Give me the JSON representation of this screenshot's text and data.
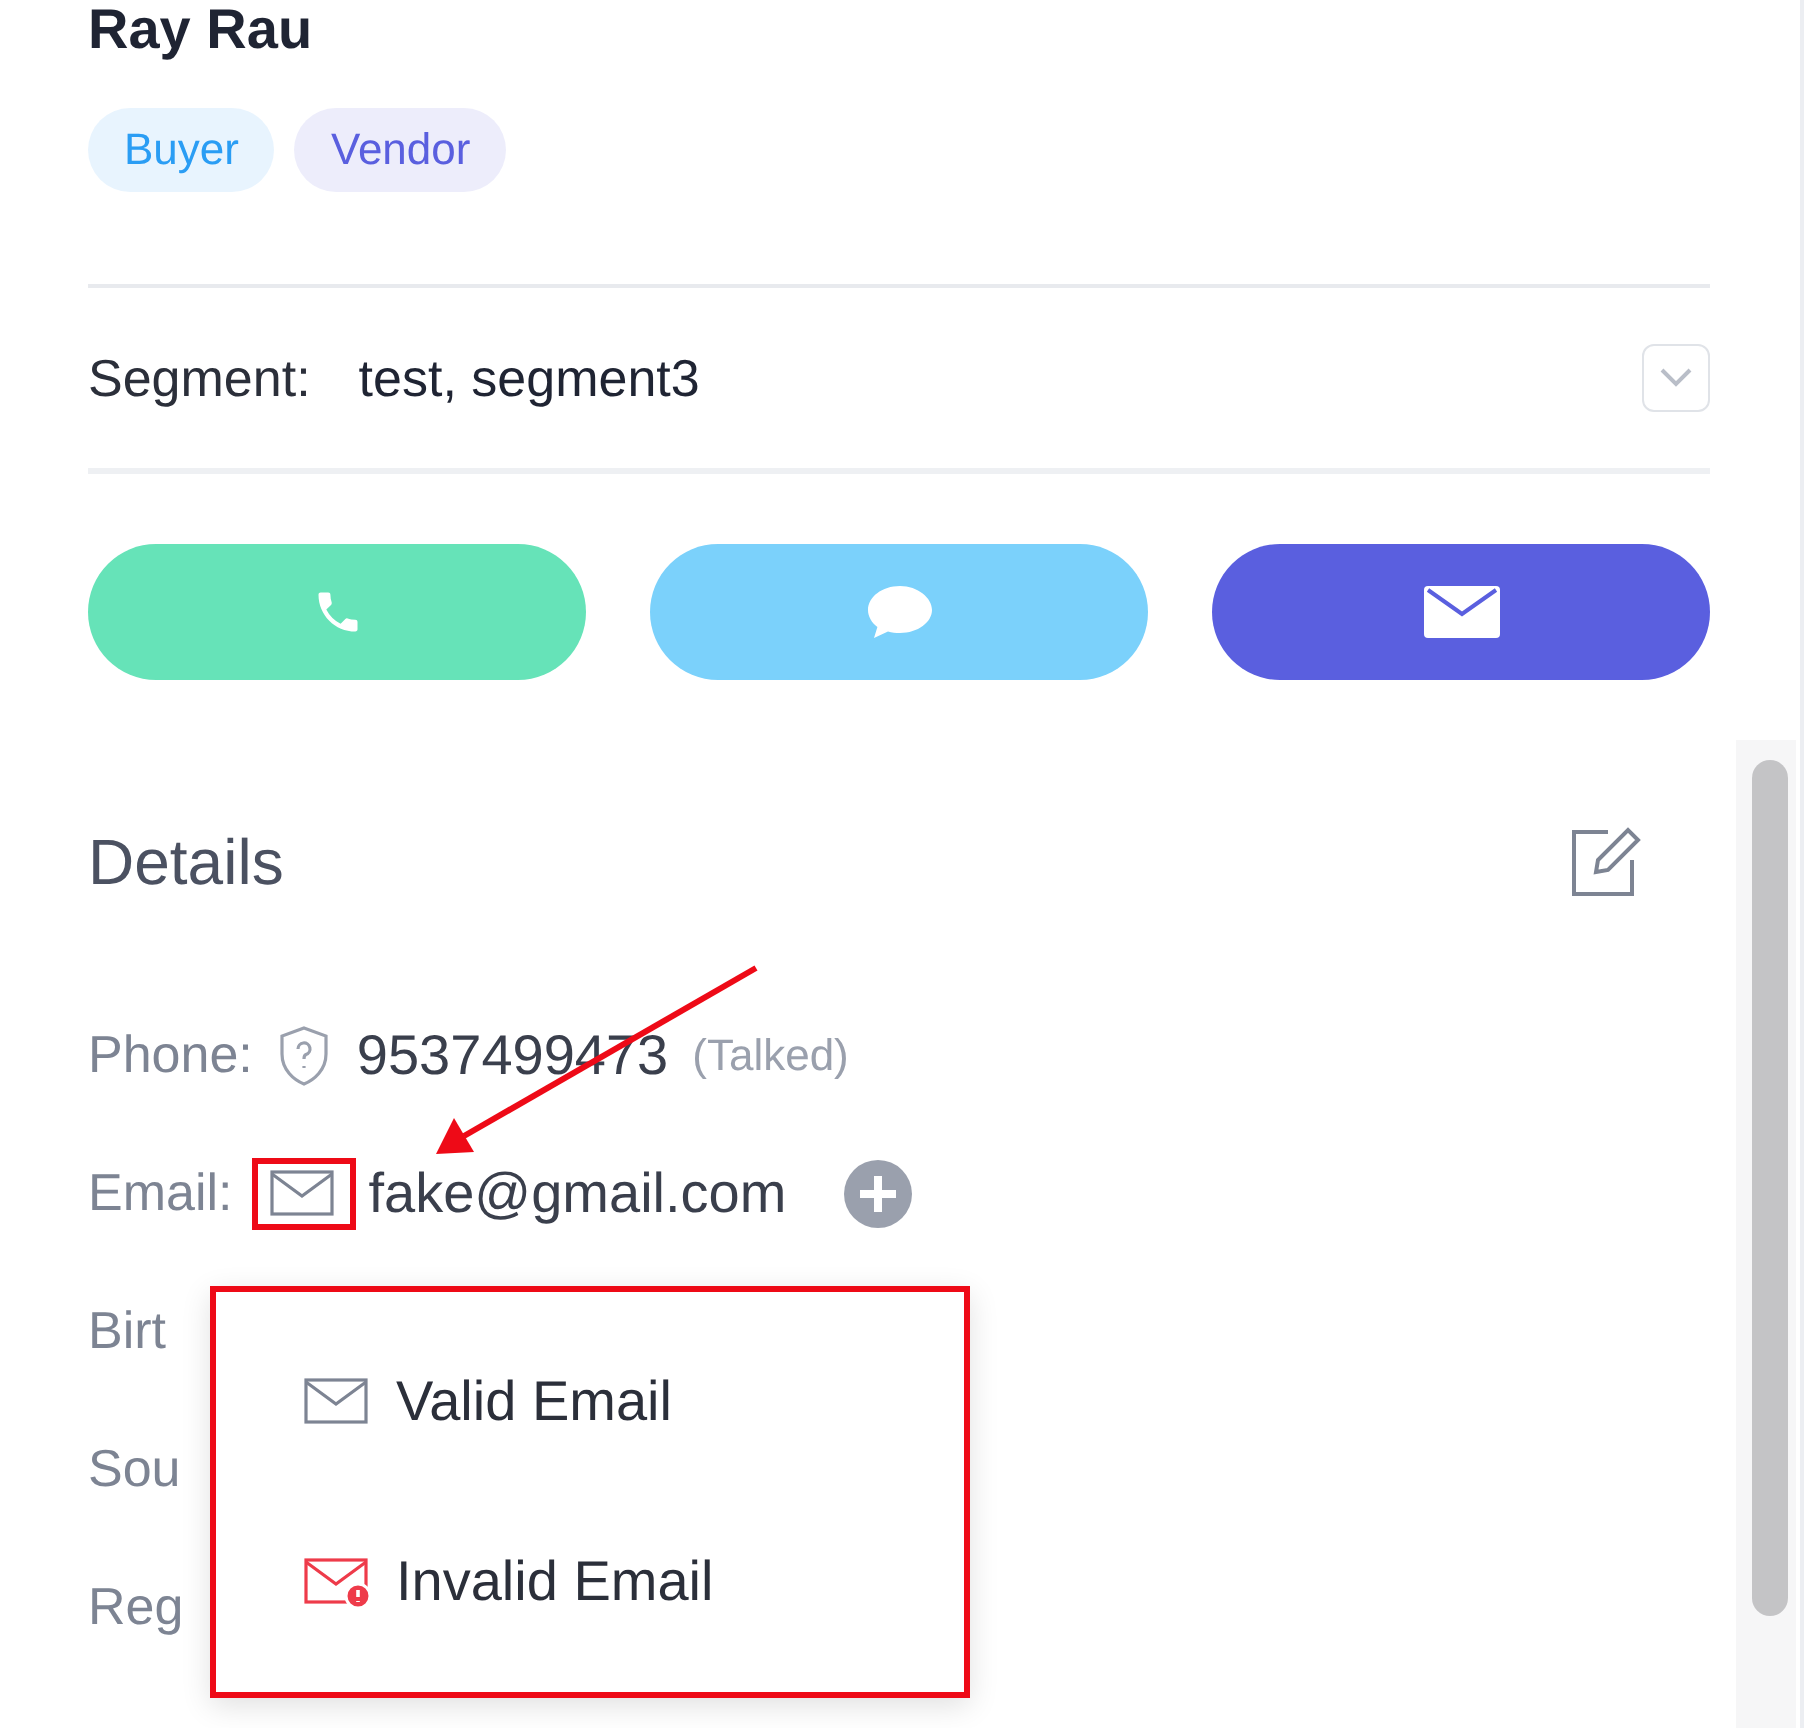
{
  "contact": {
    "name": "Ray Rau",
    "tags": [
      {
        "label": "Buyer",
        "color": "#2a9df4"
      },
      {
        "label": "Vendor",
        "color": "#5a5fdf"
      }
    ]
  },
  "segment": {
    "label": "Segment:",
    "value": "test, segment3"
  },
  "actions": [
    {
      "kind": "call"
    },
    {
      "kind": "message"
    },
    {
      "kind": "email"
    }
  ],
  "details": {
    "title": "Details",
    "rows": [
      {
        "kind": "phone",
        "label": "Phone:",
        "value": "9537499473",
        "note": "(Talked)"
      },
      {
        "kind": "email",
        "label": "Email:",
        "value": "fake@gmail.com"
      },
      {
        "kind": "plain",
        "label": "Birt"
      },
      {
        "kind": "plain",
        "label": "Sou"
      },
      {
        "kind": "plain",
        "label": "Reg"
      }
    ]
  },
  "email_status_menu": {
    "options": [
      {
        "kind": "valid",
        "label": "Valid Email"
      },
      {
        "kind": "invalid",
        "label": "Invalid Email"
      }
    ]
  }
}
